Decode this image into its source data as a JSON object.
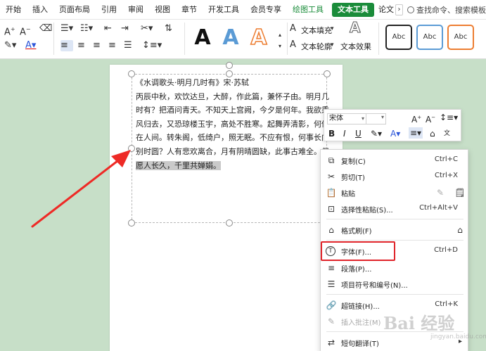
{
  "menu": {
    "tabs": [
      "开始",
      "插入",
      "页面布局",
      "引用",
      "审阅",
      "视图",
      "章节",
      "开发工具",
      "会员专享",
      "绘图工具",
      "文本工具",
      "论文"
    ],
    "search_text": "查找命令、搜索模板"
  },
  "ribbon": {
    "text_fill": "文本填充",
    "text_outline": "文本轮廓",
    "text_effect": "文本效果",
    "style_label": "Abc",
    "style_colors": [
      "#222222",
      "#5b9bd5",
      "#ed7d31"
    ],
    "accent": "#1a8c3a"
  },
  "document": {
    "lines": [
      "《水调歌头·明月几时有》宋·苏轼",
      "丙辰中秋，欢饮达旦，大醉，作此篇，兼怀子由。明月几",
      "时有？把酒问青天。不知天上宫阙，今夕是何年。我欲乘",
      "风归去，又恐琼楼玉宇，高处不胜寒。起舞弄清影，何似",
      "在人间。转朱阁，低绮户，照无眠。不应有恨，何事长向",
      "别时圆？人有悲欢离合，月有阴晴圆缺，此事古难全。但",
      "愿人长久，千里共婵娟。"
    ]
  },
  "mini_toolbar": {
    "font": "宋体"
  },
  "context_menu": {
    "items": [
      {
        "label": "复制(C)",
        "shortcut": "Ctrl+C"
      },
      {
        "label": "剪切(T)",
        "shortcut": "Ctrl+X"
      },
      {
        "label": "粘贴",
        "shortcut": ""
      },
      {
        "label": "选择性粘贴(S)...",
        "shortcut": "Ctrl+Alt+V"
      },
      {
        "label": "格式刷(F)",
        "shortcut": ""
      },
      {
        "label": "字体(F)...",
        "shortcut": "Ctrl+D"
      },
      {
        "label": "段落(P)...",
        "shortcut": ""
      },
      {
        "label": "项目符号和编号(N)...",
        "shortcut": ""
      },
      {
        "label": "超链接(H)...",
        "shortcut": "Ctrl+K"
      },
      {
        "label": "插入批注(M)",
        "shortcut": ""
      },
      {
        "label": "短句翻译(T)",
        "shortcut": ""
      }
    ]
  },
  "watermark": {
    "brand": "Bai 经验",
    "url": "jingyan.baidu.com"
  }
}
